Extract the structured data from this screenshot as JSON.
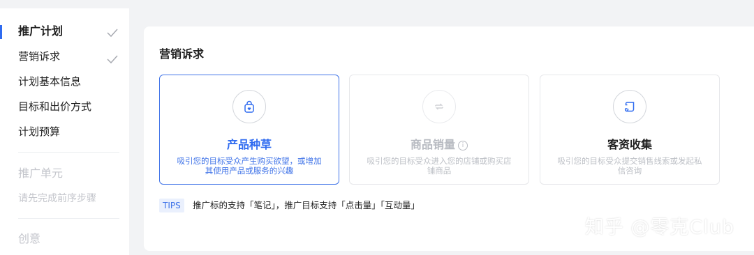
{
  "sidebar": {
    "steps": [
      {
        "label": "推广计划",
        "done": true,
        "active": true
      },
      {
        "label": "营销诉求",
        "done": true
      },
      {
        "label": "计划基本信息"
      },
      {
        "label": "目标和出价方式"
      },
      {
        "label": "计划预算"
      }
    ],
    "unit_title": "推广单元",
    "unit_hint": "请先完成前序步骤",
    "creative_title": "创意"
  },
  "main": {
    "section_title": "营销诉求",
    "cards": [
      {
        "title": "产品种草",
        "desc": "吸引您的目标受众产生购买欲望，或增加其使用产品或服务的兴趣",
        "icon": "bag-icon",
        "state": "selected"
      },
      {
        "title": "商品销量",
        "desc": "吸引您的目标受众进入您的店铺或购买店铺商品",
        "icon": "refresh-icon",
        "state": "disabled",
        "info": "i"
      },
      {
        "title": "客资收集",
        "desc": "吸引您的目标受众提交销售线索或发起私信咨询",
        "icon": "scroll-icon",
        "state": "normal"
      }
    ],
    "tips_label": "TIPS",
    "tips_text": "推广标的支持「笔记」，推广目标支持「点击量」「互动量」"
  },
  "watermark": "知乎 @零克Club",
  "colors": {
    "accent": "#2f6bf0",
    "disabled": "#bdc0c6"
  }
}
